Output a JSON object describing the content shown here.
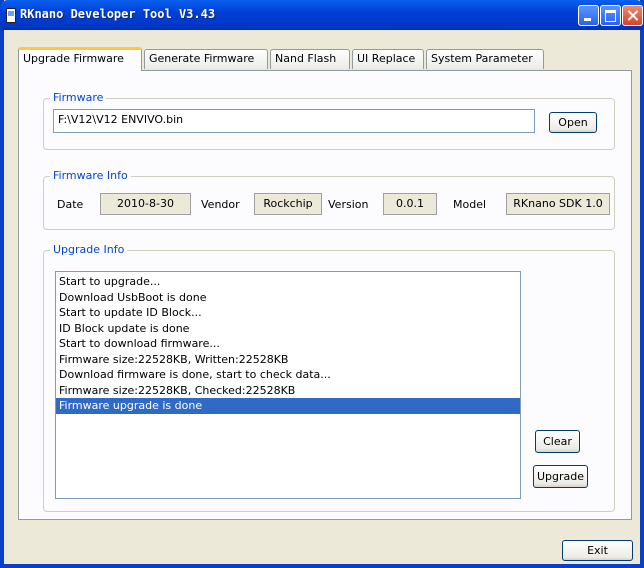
{
  "window": {
    "title": "RKnano Developer Tool V3.43"
  },
  "tabs": [
    "Upgrade Firmware",
    "Generate Firmware",
    "Nand Flash",
    "UI Replace",
    "System Parameter"
  ],
  "firmware": {
    "caption": "Firmware",
    "path": "F:\\V12\\V12 ENVIVO.bin",
    "open_label": "Open"
  },
  "firmware_info": {
    "caption": "Firmware Info",
    "date_label": "Date",
    "date": "2010-8-30",
    "vendor_label": "Vendor",
    "vendor": "Rockchip",
    "version_label": "Version",
    "version": "0.0.1",
    "model_label": "Model",
    "model": "RKnano SDK 1.0"
  },
  "upgrade_info": {
    "caption": "Upgrade Info",
    "log": [
      "Start to upgrade...",
      "Download UsbBoot is done",
      "Start to update ID Block...",
      "ID Block update is done",
      "Start to download firmware...",
      "Firmware size:22528KB, Written:22528KB",
      "Download firmware is done, start to check data...",
      "Firmware size:22528KB, Checked:22528KB",
      "Firmware upgrade is done"
    ],
    "selected_line": "Firmware upgrade is done",
    "clear_label": "Clear",
    "upgrade_label": "Upgrade"
  },
  "exit_label": "Exit",
  "colors": {
    "titlebar": "#0040D8",
    "caption": "#0046D5",
    "selection": "#316AC5",
    "active_tab_accent": "#FFC83C"
  }
}
